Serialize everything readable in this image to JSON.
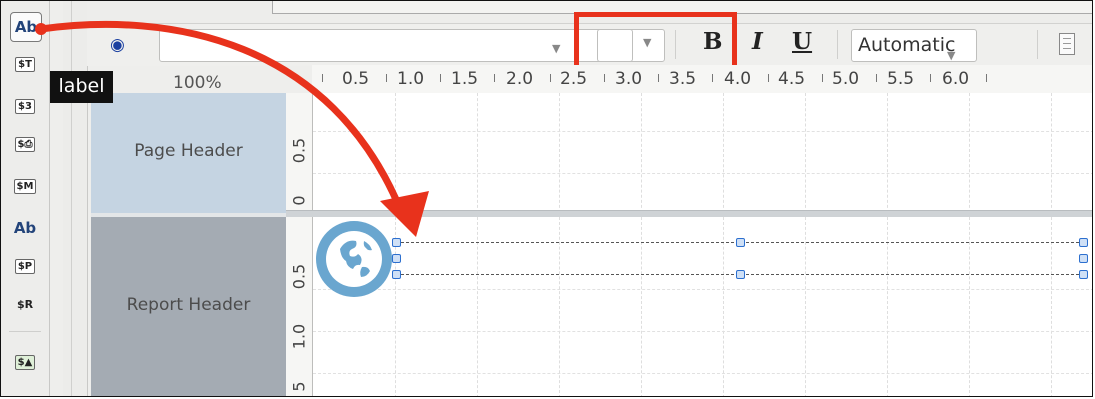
{
  "palette": {
    "items": [
      {
        "label": "Ab",
        "icon": "label-icon"
      },
      {
        "label": "$T",
        "icon": "text-field-icon"
      },
      {
        "label": "$3",
        "icon": "number-field-icon"
      },
      {
        "label": "$⎙",
        "icon": "resource-field-icon"
      },
      {
        "label": "$M",
        "icon": "message-field-icon"
      },
      {
        "label": "Ab",
        "icon": "resource-label-icon"
      },
      {
        "label": "$P",
        "icon": "resource-message-icon"
      },
      {
        "label": "$R",
        "icon": "formula-icon"
      },
      {
        "label": "$▲",
        "icon": "chart-icon"
      }
    ],
    "tooltip": "label"
  },
  "toolbar": {
    "eye_icon": "eye-icon",
    "font_name_value": "",
    "font_size_value": "",
    "bold_label": "B",
    "italic_label": "I",
    "underline_label": "U",
    "color_value": "Automatic",
    "doc_icon": "document-icon",
    "highlight_color": "#e8321c"
  },
  "ruler": {
    "zoom": "100%",
    "marks": [
      "0.5",
      "1.0",
      "1.5",
      "2.0",
      "2.5",
      "3.0",
      "3.5",
      "4.0",
      "4.5",
      "5.0",
      "5.5",
      "6.0"
    ]
  },
  "bands": {
    "page_header": {
      "label": "Page Header",
      "ruler": [
        "0.5",
        "0"
      ]
    },
    "report_header": {
      "label": "Report Header",
      "ruler": [
        "0.5",
        "1.0",
        "5"
      ]
    }
  },
  "colors": {
    "page_header_band": "#c5d4e2",
    "report_header_band": "#a4abb3",
    "arrow": "#e8321c",
    "globe": "#6aa6cf"
  }
}
